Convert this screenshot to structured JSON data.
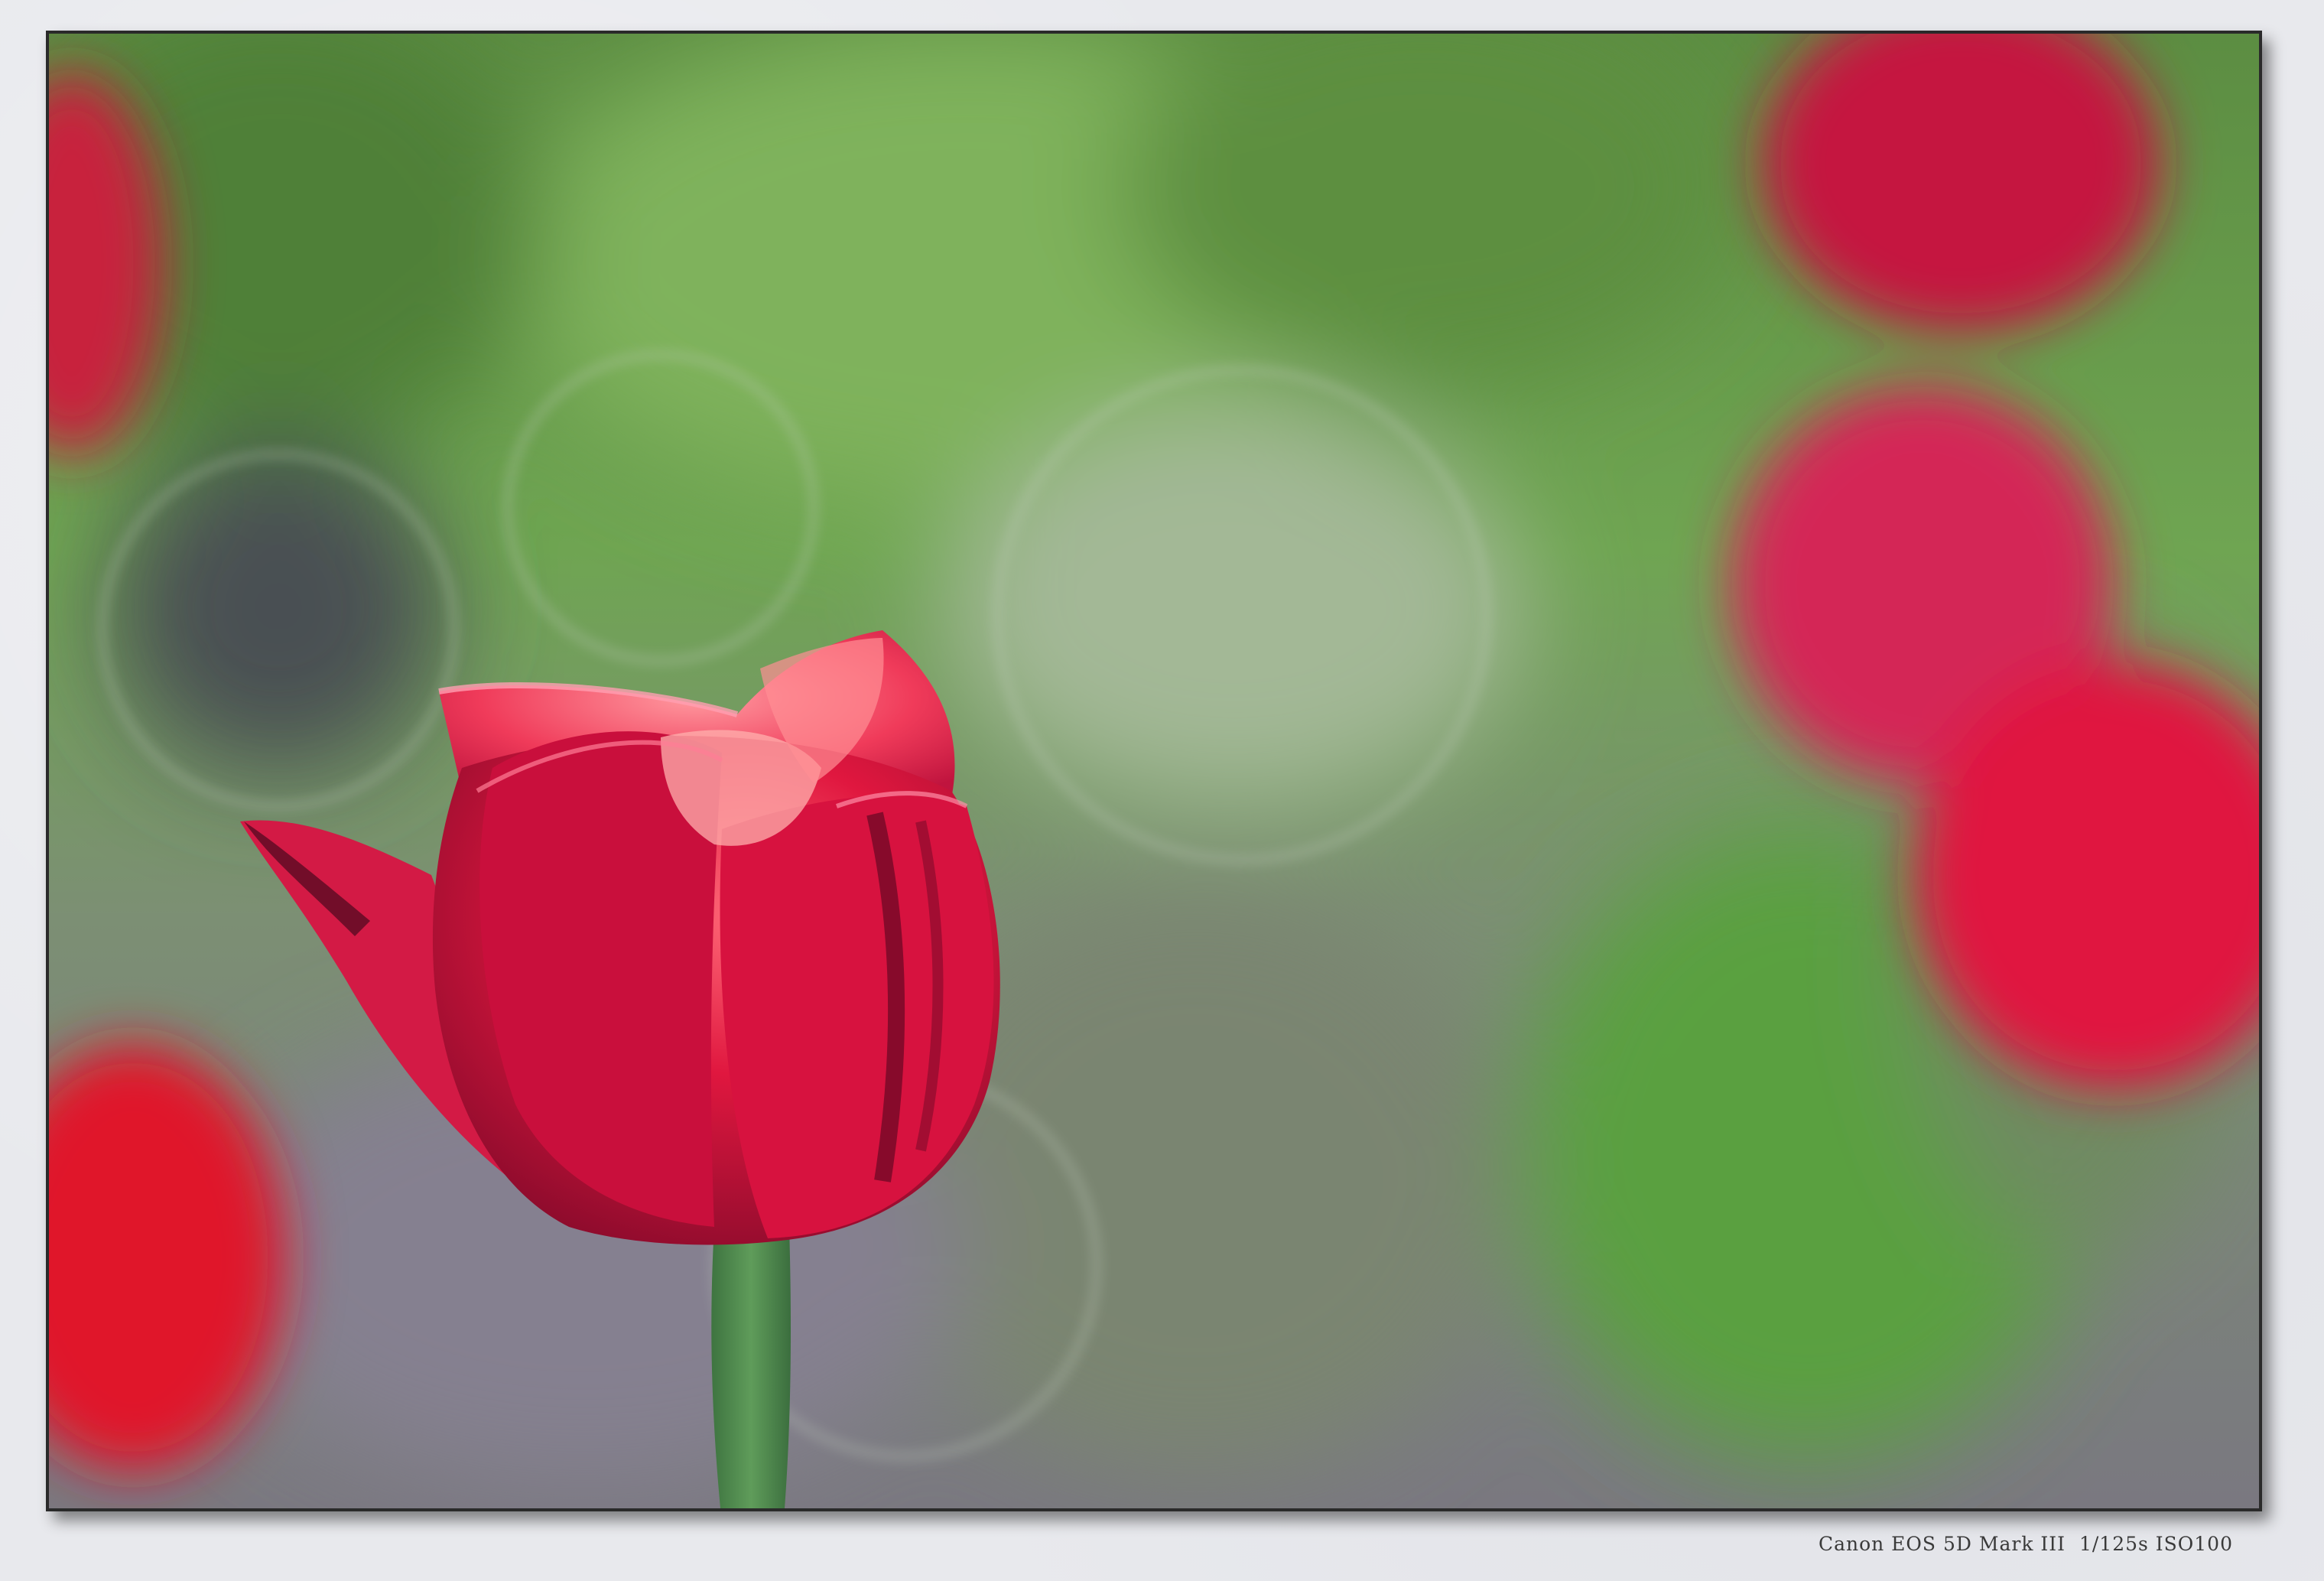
{
  "photo": {
    "caption": "Canon EOS 5D Mark III  1/125s ISO100",
    "subject_icon": "tulip-flower",
    "colors": {
      "background_green": "#6b9a4e",
      "tulip_red": "#d7123f",
      "tulip_highlight": "#ff6b78",
      "stem_green": "#4d8a4a",
      "mat": "#e8e9ed",
      "frame_border": "#2a2a2a"
    }
  }
}
